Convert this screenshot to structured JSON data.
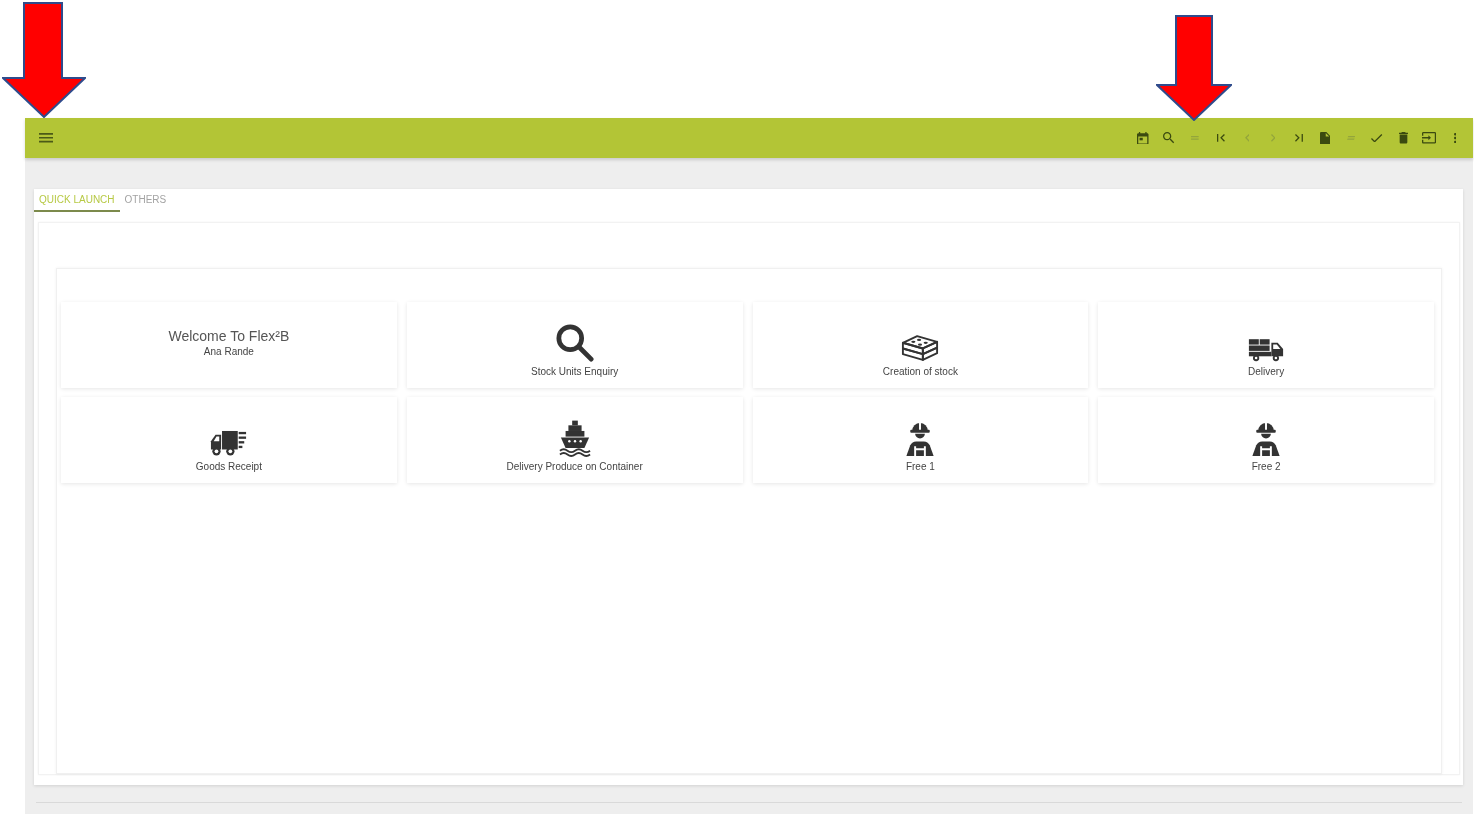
{
  "toolbar": {
    "actions": [
      {
        "kind": "calendar",
        "disabled": false
      },
      {
        "kind": "search",
        "disabled": false
      },
      {
        "kind": "equals",
        "disabled": true
      },
      {
        "kind": "first",
        "disabled": false
      },
      {
        "kind": "previous",
        "disabled": true
      },
      {
        "kind": "next",
        "disabled": true
      },
      {
        "kind": "last",
        "disabled": false
      },
      {
        "kind": "document",
        "disabled": false
      },
      {
        "kind": "lines",
        "disabled": true
      },
      {
        "kind": "check",
        "disabled": false
      },
      {
        "kind": "trash",
        "disabled": false
      },
      {
        "kind": "enter",
        "disabled": false
      },
      {
        "kind": "more",
        "disabled": false
      }
    ]
  },
  "tabs": [
    {
      "label": "QUICK LAUNCH",
      "selected": true
    },
    {
      "label": "OTHERS",
      "selected": false
    }
  ],
  "tiles": [
    {
      "kind": "welcome",
      "title": "Welcome To Flex²B",
      "subtitle": "Ana Rande"
    },
    {
      "kind": "magnifier",
      "label": "Stock Units Enquiry"
    },
    {
      "kind": "bricks",
      "label": "Creation of stock"
    },
    {
      "kind": "box-truck",
      "label": "Delivery"
    },
    {
      "kind": "fast-truck",
      "label": "Goods Receipt"
    },
    {
      "kind": "ship",
      "label": "Delivery Produce on Container"
    },
    {
      "kind": "worker",
      "label": "Free 1"
    },
    {
      "kind": "worker",
      "label": "Free 2"
    }
  ]
}
